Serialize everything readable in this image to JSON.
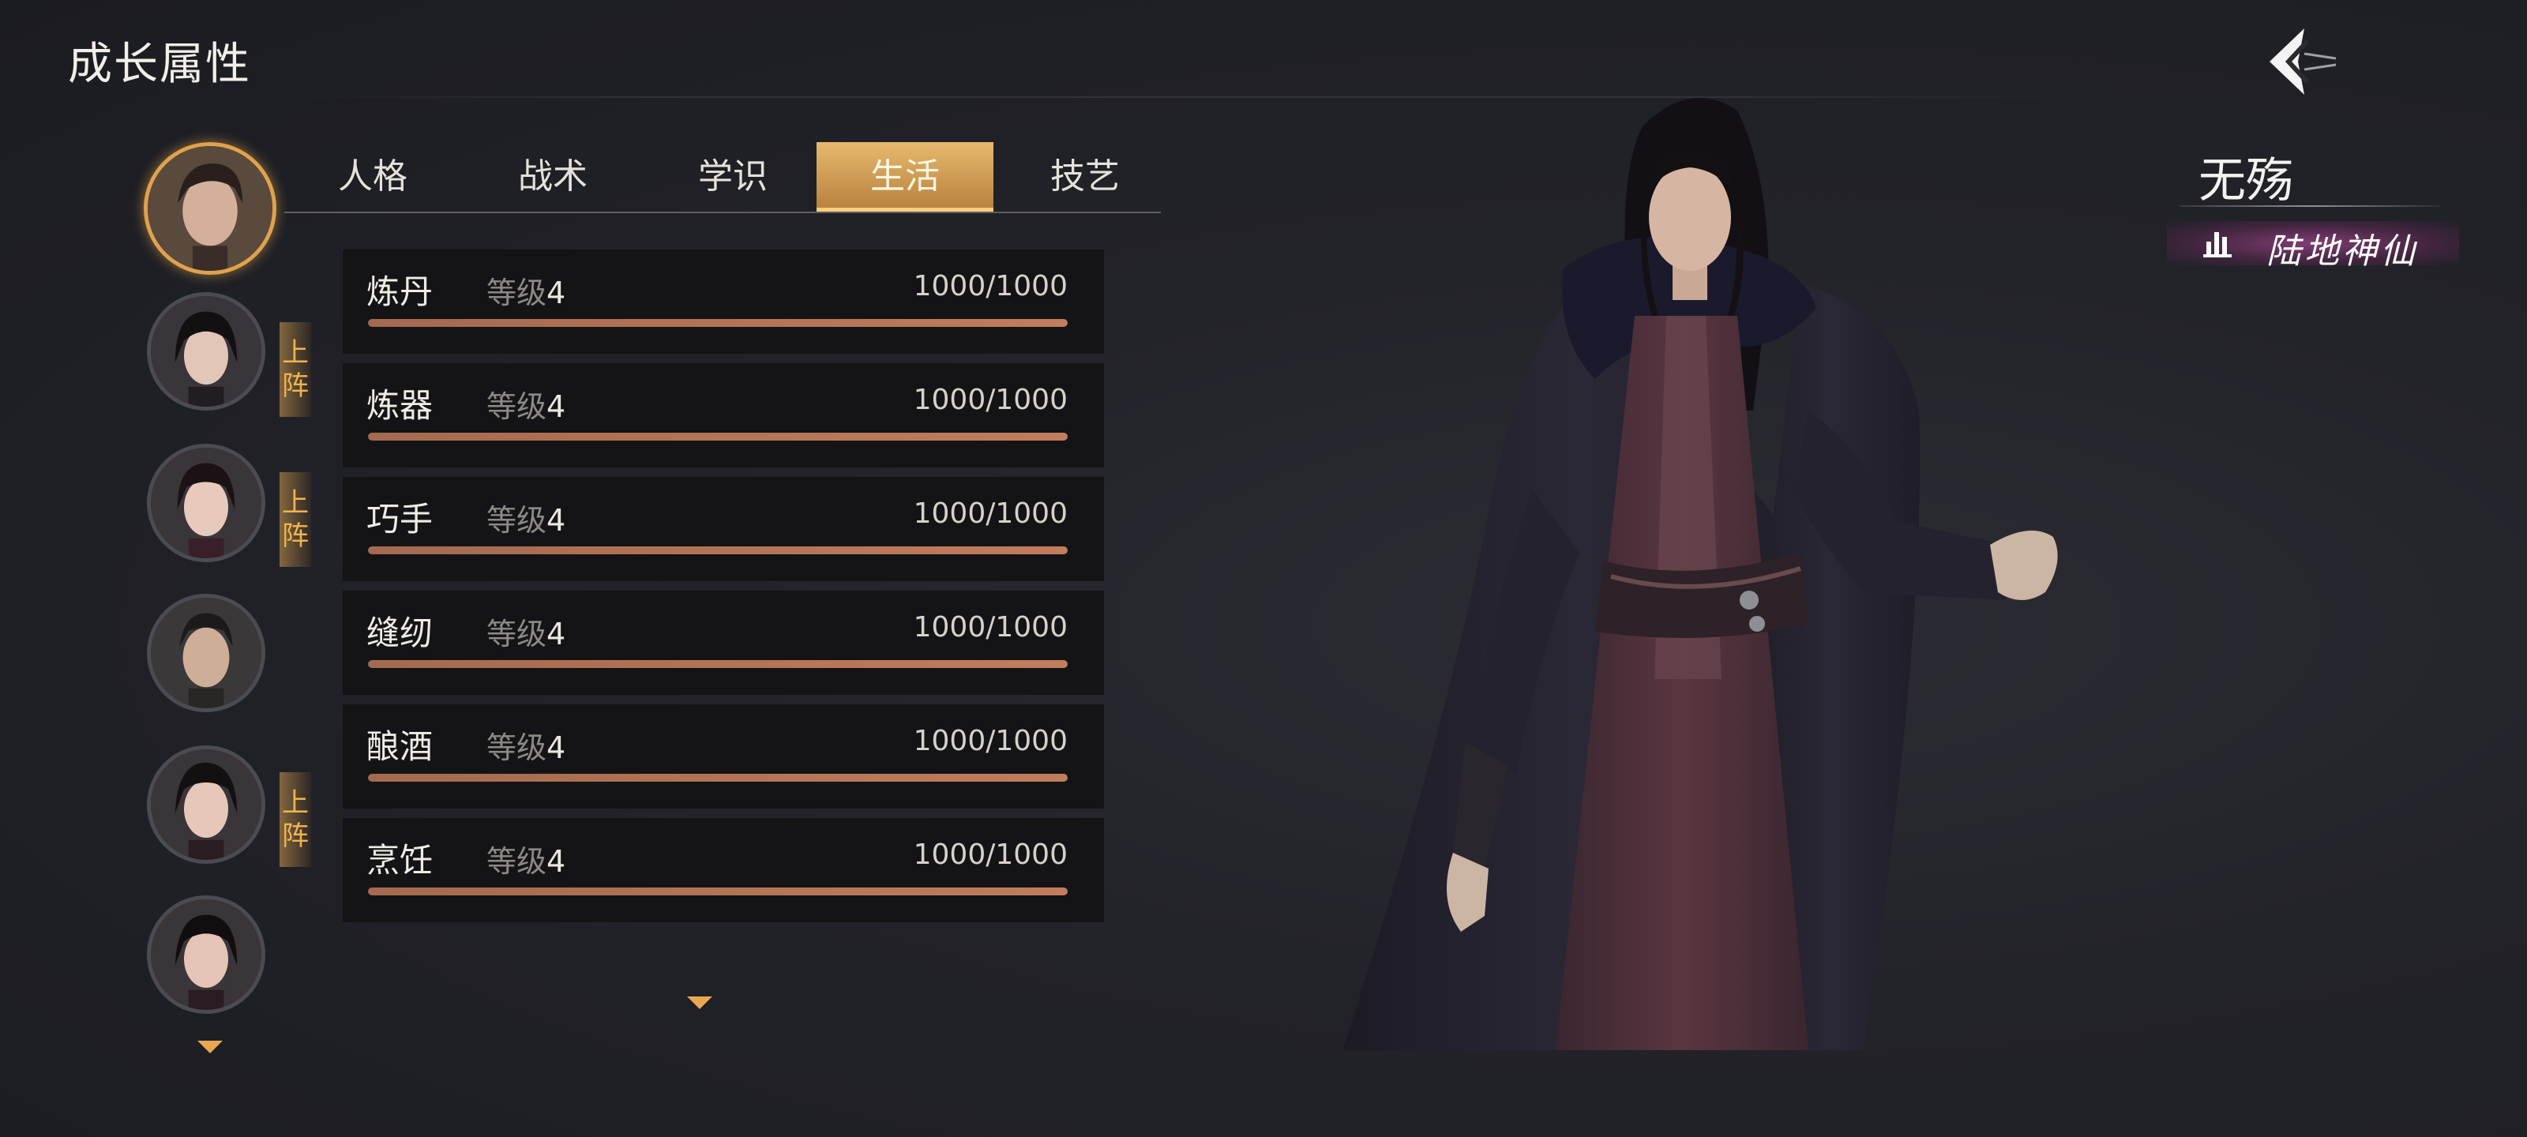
{
  "page": {
    "title": "成长属性"
  },
  "tabs": [
    {
      "label": "人格",
      "active": false
    },
    {
      "label": "战术",
      "active": false
    },
    {
      "label": "学识",
      "active": false
    },
    {
      "label": "生活",
      "active": true
    },
    {
      "label": "技艺",
      "active": false
    }
  ],
  "skills": [
    {
      "name": "炼丹",
      "level_label": "等级",
      "level": "4",
      "xp": "1000/1000",
      "progress": 1.0
    },
    {
      "name": "炼器",
      "level_label": "等级",
      "level": "4",
      "xp": "1000/1000",
      "progress": 1.0
    },
    {
      "name": "巧手",
      "level_label": "等级",
      "level": "4",
      "xp": "1000/1000",
      "progress": 1.0
    },
    {
      "name": "缝纫",
      "level_label": "等级",
      "level": "4",
      "xp": "1000/1000",
      "progress": 1.0
    },
    {
      "name": "酿酒",
      "level_label": "等级",
      "level": "4",
      "xp": "1000/1000",
      "progress": 1.0
    },
    {
      "name": "烹饪",
      "level_label": "等级",
      "level": "4",
      "xp": "1000/1000",
      "progress": 1.0
    }
  ],
  "roster": [
    {
      "selected": true,
      "badge": ""
    },
    {
      "selected": false,
      "badge": "上阵"
    },
    {
      "selected": false,
      "badge": "上阵"
    },
    {
      "selected": false,
      "badge": ""
    },
    {
      "selected": false,
      "badge": "上阵"
    },
    {
      "selected": false,
      "badge": ""
    }
  ],
  "character": {
    "name": "无殇",
    "realm": "陆地神仙"
  },
  "colors": {
    "accent": "#e0a24c",
    "bar_fill": "#b57356",
    "badge_text": "#f0b54e",
    "realm_glow": "#a0468c"
  },
  "icons": {
    "back": "back-arrow-icon",
    "more_down": "chevron-down-icon",
    "realm": "realm-rank-icon"
  }
}
